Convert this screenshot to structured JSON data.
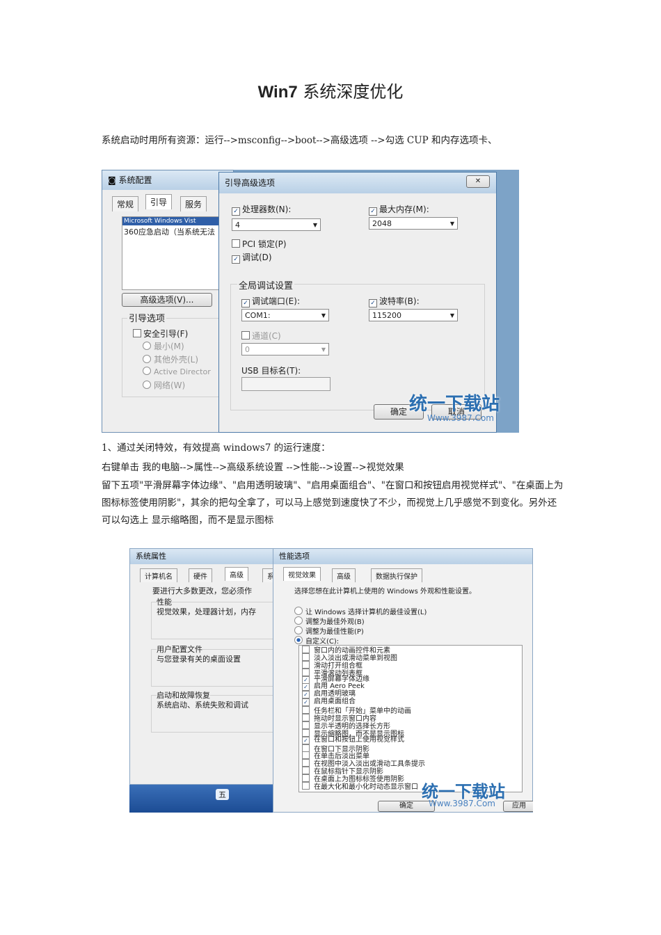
{
  "doc": {
    "title_en": "Win7",
    "title_cn": " 系统深度优化",
    "p1": "系统启动时用所有资源：运行-->msconfig-->boot-->高级选项 -->勾选 CUP 和内存选项卡、",
    "p2": "1、通过关闭特效，有效提高 windows7 的运行速度：",
    "p3": "右键单击 我的电脑-->属性-->高级系统设置 -->性能-->设置-->视觉效果",
    "p4": "留下五项\"平滑屏幕字体边缘\"、\"启用透明玻璃\"、\"启用桌面组合\"、\"在窗口和按钮启用视觉样式\"、\"在桌面上为图标标签使用阴影\"，其余的把勾全拿了，可以马上感觉到速度快了不少，而视觉上几乎感觉不到变化。另外还可以勾选上 显示缩略图，而不是显示图标"
  },
  "shot1": {
    "syscfg_title": "系统配置",
    "tabs": [
      "常规",
      "引导",
      "服务"
    ],
    "list_line1": "Microsoft Windows Vist",
    "list_line2": "360应急启动（当系统无法",
    "adv_btn": "高级选项(V)...",
    "boot_opts": "引导选项",
    "safe_boot": "安全引导(F)",
    "radio": [
      "最小(M)",
      "其他外壳(L)",
      "Active Director",
      "网络(W)"
    ],
    "dlg_title": "引导高级选项",
    "close": "✕",
    "cpu": "处理器数(N):",
    "cpu_val": "4",
    "mem": "最大内存(M):",
    "mem_val": "2048",
    "pci": "PCI 锁定(P)",
    "debug": "调试(D)",
    "global": "全局调试设置",
    "port": "调试端口(E):",
    "port_val": "COM1:",
    "baud": "波特率(B):",
    "baud_val": "115200",
    "channel": "通道(C)",
    "channel_val": "0",
    "usb": "USB 目标名(T):",
    "ok": "确定",
    "cancel": "取消",
    "wm_cn": "统一下载站",
    "wm_url": "Www.3987.Com"
  },
  "shot2": {
    "sysprop_title": "系统属性",
    "tabs_left": [
      "计算机名",
      "硬件",
      "高级",
      "系"
    ],
    "admin_note": "要进行大多数更改，您必须作",
    "perf": "性能",
    "perf_desc": "视觉效果，处理器计划，内存",
    "profile": "用户配置文件",
    "profile_desc": "与您登录有关的桌面设置",
    "startup": "启动和故障恢复",
    "startup_desc": "系统启动、系统失败和调试",
    "perf_title": "性能选项",
    "tabs_right": [
      "视觉效果",
      "高级",
      "数据执行保护"
    ],
    "prompt": "选择您想在此计算机上使用的 Windows 外观和性能设置。",
    "radios": [
      "让 Windows 选择计算机的最佳设置(L)",
      "调整为最佳外观(B)",
      "调整为最佳性能(P)",
      "自定义(C):"
    ],
    "items": [
      {
        "label": "窗口内的动画控件和元素",
        "checked": false
      },
      {
        "label": "淡入淡出或滑动菜单到视图",
        "checked": false
      },
      {
        "label": "滑动打开组合框",
        "checked": false
      },
      {
        "label": "平滑滚动列表框",
        "checked": false
      },
      {
        "label": "平滑屏幕字体边缘",
        "checked": true
      },
      {
        "label": "启用 Aero Peek",
        "checked": true
      },
      {
        "label": "启用透明玻璃",
        "checked": true
      },
      {
        "label": "启用桌面组合",
        "checked": true
      },
      {
        "label": "任务栏和「开始」菜单中的动画",
        "checked": false
      },
      {
        "label": "拖动时显示窗口内容",
        "checked": false
      },
      {
        "label": "显示半透明的选择长方形",
        "checked": false
      },
      {
        "label": "显示缩略图，而不是显示图标",
        "checked": false
      },
      {
        "label": "在窗口和按钮上使用视觉样式",
        "checked": true
      },
      {
        "label": "在窗口下显示阴影",
        "checked": false
      },
      {
        "label": "在单击后淡出菜单",
        "checked": false
      },
      {
        "label": "在视图中淡入淡出或滑动工具条提示",
        "checked": false
      },
      {
        "label": "在鼠标指针下显示阴影",
        "checked": false
      },
      {
        "label": "在桌面上为图标标签使用阴影",
        "checked": false
      },
      {
        "label": "在最大化和最小化时动态显示窗口",
        "checked": false
      }
    ],
    "ok": "确定",
    "apply": "应用",
    "taskbar": "五",
    "wm_cn": "统一下载站",
    "wm_url": "Www.3987.Com"
  }
}
